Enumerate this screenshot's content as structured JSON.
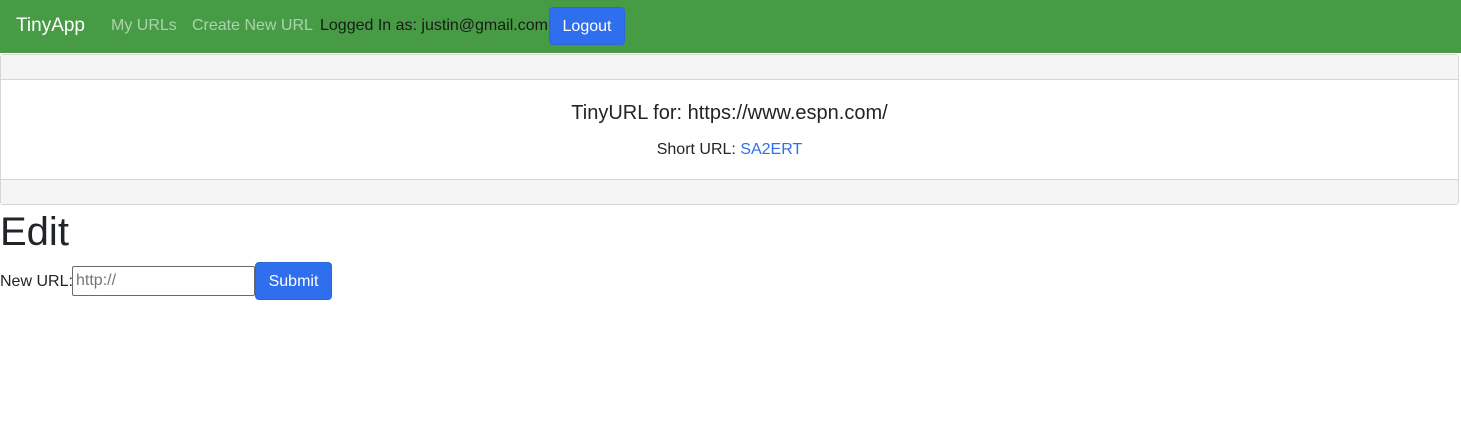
{
  "navbar": {
    "brand": "TinyApp",
    "links": [
      {
        "label": "My URLs"
      },
      {
        "label": "Create New URL"
      }
    ],
    "logged_in_text": "Logged In as: justin@gmail.com",
    "logout_label": "Logout"
  },
  "card": {
    "title": "TinyURL for: https://www.espn.com/",
    "short_url_label": "Short URL: ",
    "short_url_value": "SA2ERT"
  },
  "edit": {
    "heading": "Edit",
    "new_url_label": "New URL:",
    "input_placeholder": "http://",
    "input_value": "",
    "submit_label": "Submit"
  },
  "colors": {
    "navbar_bg": "#479b45",
    "primary": "#2f6fee"
  }
}
